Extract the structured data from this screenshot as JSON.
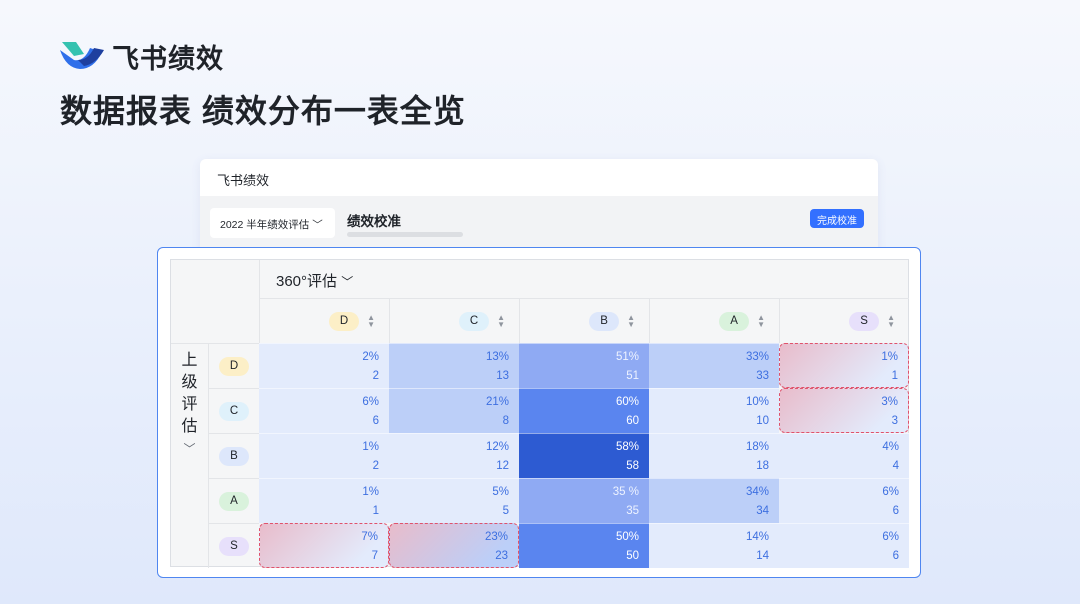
{
  "brand": "飞书绩效",
  "headline": "数据报表 绩效分布一表全览",
  "card": {
    "title": "飞书绩效",
    "cycle_select": "2022 半年绩效评估",
    "section_title": "绩效校准",
    "complete_button": "完成校准"
  },
  "table": {
    "column_group": "360°评估",
    "row_group": "上级评估",
    "columns": [
      "D",
      "C",
      "B",
      "A",
      "S"
    ],
    "rows": [
      "D",
      "C",
      "B",
      "A",
      "S"
    ],
    "grade_colors": {
      "D": "#fcefc7",
      "C": "#dff1fb",
      "B": "#dde7fb",
      "A": "#d9f2dc",
      "S": "#e7e0fb"
    },
    "level_colors": [
      "#e3ebfc",
      "#bccff8",
      "#8faaf3",
      "#5a85ef",
      "#2d5bd2"
    ],
    "cells": [
      [
        {
          "pct": "2%",
          "n": "2",
          "level": 0
        },
        {
          "pct": "13%",
          "n": "13",
          "level": 1
        },
        {
          "pct": "51%",
          "n": "51",
          "level": 2
        },
        {
          "pct": "33%",
          "n": "33",
          "level": 1
        },
        {
          "pct": "1%",
          "n": "1",
          "level": 0,
          "highlight": true
        }
      ],
      [
        {
          "pct": "6%",
          "n": "6",
          "level": 0
        },
        {
          "pct": "21%",
          "n": "8",
          "level": 1
        },
        {
          "pct": "60%",
          "n": "60",
          "level": 3
        },
        {
          "pct": "10%",
          "n": "10",
          "level": 0
        },
        {
          "pct": "3%",
          "n": "3",
          "level": 0,
          "highlight": true
        }
      ],
      [
        {
          "pct": "1%",
          "n": "2",
          "level": 0
        },
        {
          "pct": "12%",
          "n": "12",
          "level": 0
        },
        {
          "pct": "58%",
          "n": "58",
          "level": 4
        },
        {
          "pct": "18%",
          "n": "18",
          "level": 0
        },
        {
          "pct": "4%",
          "n": "4",
          "level": 0
        }
      ],
      [
        {
          "pct": "1%",
          "n": "1",
          "level": 0
        },
        {
          "pct": "5%",
          "n": "5",
          "level": 0
        },
        {
          "pct": "35 %",
          "n": "35",
          "level": 2
        },
        {
          "pct": "34%",
          "n": "34",
          "level": 1
        },
        {
          "pct": "6%",
          "n": "6",
          "level": 0
        }
      ],
      [
        {
          "pct": "7%",
          "n": "7",
          "level": 0,
          "highlight": true
        },
        {
          "pct": "23%",
          "n": "23",
          "level": 1,
          "highlight": true
        },
        {
          "pct": "50%",
          "n": "50",
          "level": 3
        },
        {
          "pct": "14%",
          "n": "14",
          "level": 0
        },
        {
          "pct": "6%",
          "n": "6",
          "level": 0
        }
      ]
    ]
  }
}
